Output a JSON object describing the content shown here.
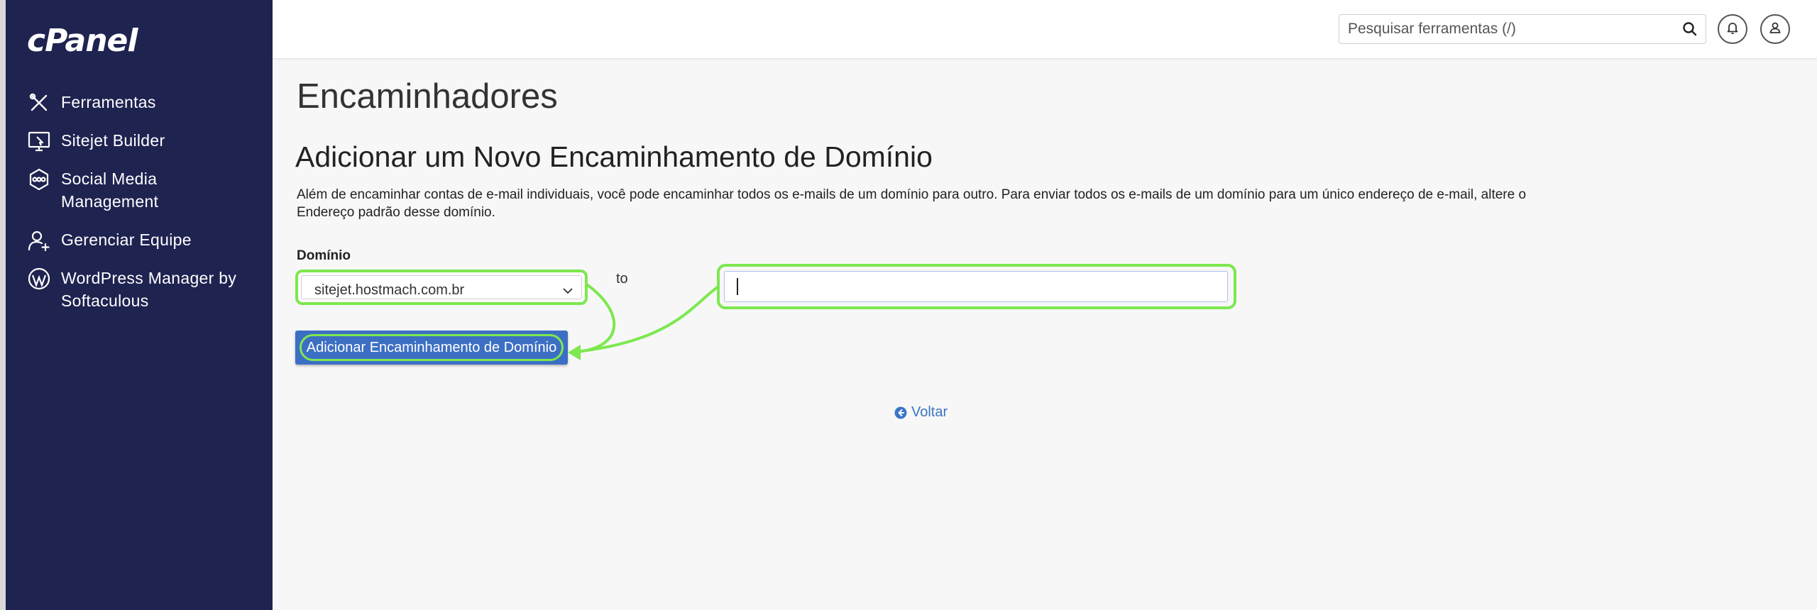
{
  "app": {
    "logo": "cPanel"
  },
  "sidebar": {
    "items": [
      {
        "label": "Ferramentas",
        "icon": "tools-icon"
      },
      {
        "label": "Sitejet Builder",
        "icon": "sitejet-icon"
      },
      {
        "label": "Social Media Management",
        "icon": "social-media-icon"
      },
      {
        "label": "Gerenciar Equipe",
        "icon": "user-add-icon"
      },
      {
        "label": "WordPress Manager by Softaculous",
        "icon": "wordpress-icon"
      }
    ]
  },
  "topbar": {
    "search_placeholder": "Pesquisar ferramentas (/)"
  },
  "main": {
    "page_title": "Encaminhadores",
    "section_title": "Adicionar um Novo Encaminhamento de Domínio",
    "description": "Além de encaminhar contas de e-mail individuais, você pode encaminhar todos os e-mails de um domínio para outro. Para enviar todos os e-mails de um domínio para um único endereço de e-mail, altere o Endereço padrão desse domínio.",
    "domain_label": "Domínio",
    "domain_selected": "sitejet.hostmach.com.br",
    "to_label": "to",
    "destination_value": "",
    "add_button": "Adicionar Encaminhamento de Domínio",
    "back_link": "Voltar"
  },
  "colors": {
    "sidebar_bg": "#1f2350",
    "highlight": "#7de84f",
    "button_bg": "#3c6fc4",
    "link": "#3a75c4"
  }
}
